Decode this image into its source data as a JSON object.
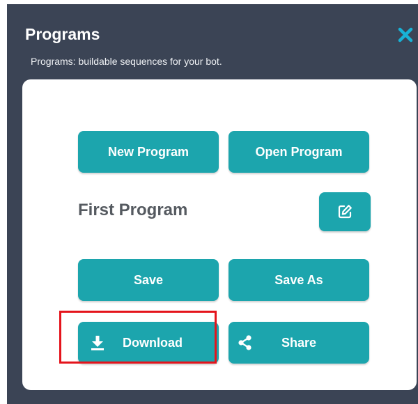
{
  "window": {
    "title": "Programs",
    "subtitle": "Programs: buildable sequences for your bot."
  },
  "buttons": {
    "new_program": "New Program",
    "open_program": "Open Program",
    "save": "Save",
    "save_as": "Save As",
    "download": "Download",
    "share": "Share"
  },
  "program": {
    "name": "First Program"
  },
  "icons": {
    "close": "close-icon",
    "edit": "edit-icon",
    "download": "download-icon",
    "share": "share-icon"
  },
  "colors": {
    "panel_bg": "#3b4455",
    "accent": "#1ca5ad",
    "close_icon": "#18b2d6",
    "highlight": "#e4141c"
  }
}
